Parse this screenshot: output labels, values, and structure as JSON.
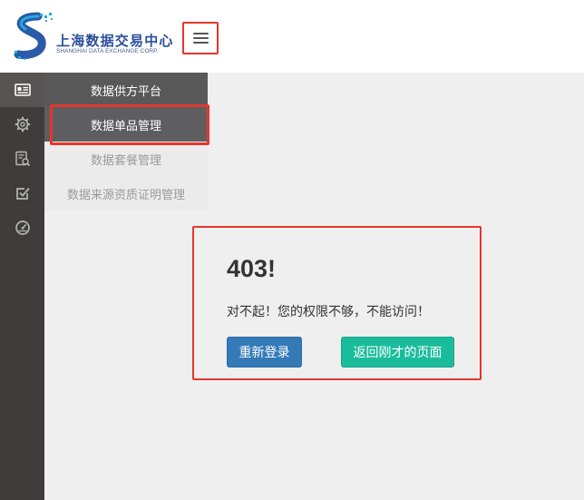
{
  "header": {
    "logo_cn": "上海数据交易中心",
    "logo_en": "SHANGHAI DATA EXCHANGE CORP.",
    "menu_toggle_icon": "hamburger-menu-icon"
  },
  "sidebar": {
    "icons": [
      "id-card-icon",
      "gear-icon",
      "report-search-icon",
      "checkbox-icon",
      "dashboard-gauge-icon"
    ]
  },
  "submenu": {
    "title": "数据供方平台",
    "items": [
      {
        "label": "数据单品管理",
        "selected": true
      },
      {
        "label": "数据套餐管理",
        "selected": false
      },
      {
        "label": "数据来源资质证明管理",
        "selected": false
      }
    ]
  },
  "error": {
    "code": "403!",
    "message": "对不起！您的权限不够，不能访问！",
    "relogin_label": "重新登录",
    "back_label": "返回刚才的页面"
  },
  "colors": {
    "highlight": "#e5362c",
    "primary_button": "#337ab7",
    "success_button": "#1abc9c",
    "sidebar_bg": "#403c3c",
    "logo_blue": "#2b4f9b"
  }
}
